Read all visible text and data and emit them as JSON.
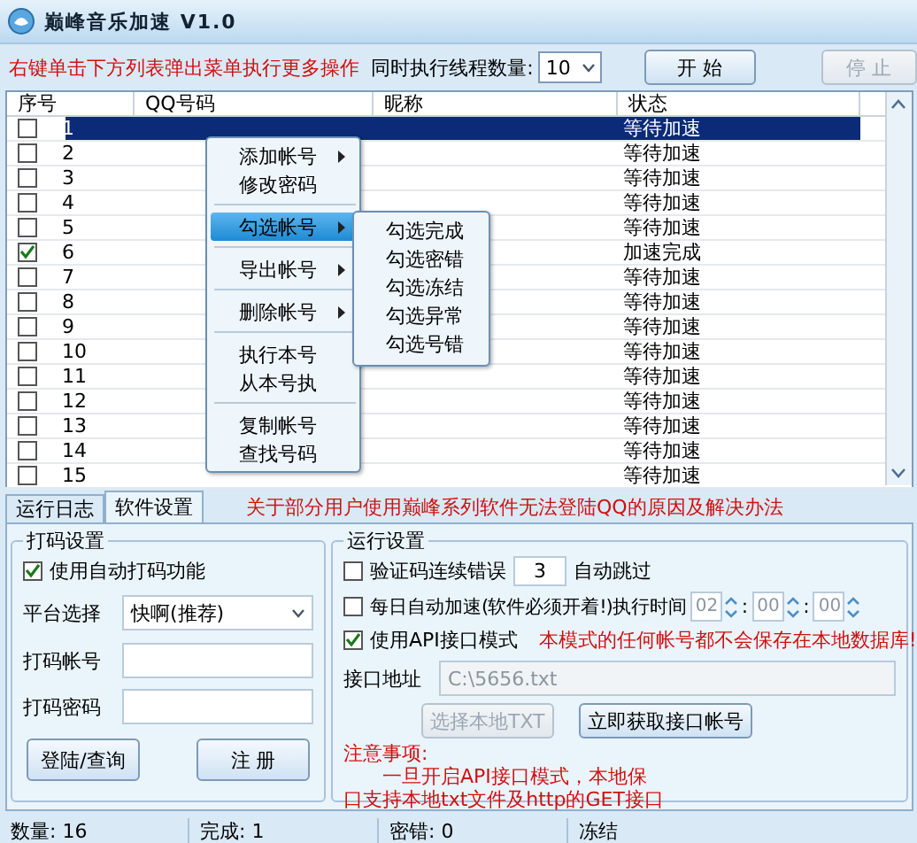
{
  "window": {
    "title": "巅峰音乐加速 V1.0"
  },
  "toolbar": {
    "hint": "右键单击下方列表弹出菜单执行更多操作",
    "threads_label": "同时执行线程数量:",
    "threads_value": "10",
    "buttons": [
      {
        "label": "开 始",
        "disabled": false
      },
      {
        "label": "停 止",
        "disabled": true
      }
    ]
  },
  "table": {
    "columns": [
      "序号",
      "QQ号码",
      "昵称",
      "状态"
    ],
    "rows": [
      {
        "index": "1",
        "checked": false,
        "selected": true,
        "status": "等待加速"
      },
      {
        "index": "2",
        "checked": false,
        "selected": false,
        "status": "等待加速"
      },
      {
        "index": "3",
        "checked": false,
        "selected": false,
        "status": "等待加速"
      },
      {
        "index": "4",
        "checked": false,
        "selected": false,
        "status": "等待加速"
      },
      {
        "index": "5",
        "checked": false,
        "selected": false,
        "status": "等待加速"
      },
      {
        "index": "6",
        "checked": true,
        "selected": false,
        "status": "加速完成"
      },
      {
        "index": "7",
        "checked": false,
        "selected": false,
        "status": "等待加速"
      },
      {
        "index": "8",
        "checked": false,
        "selected": false,
        "status": "等待加速"
      },
      {
        "index": "9",
        "checked": false,
        "selected": false,
        "status": "等待加速"
      },
      {
        "index": "10",
        "checked": false,
        "selected": false,
        "status": "等待加速"
      },
      {
        "index": "11",
        "checked": false,
        "selected": false,
        "status": "等待加速"
      },
      {
        "index": "12",
        "checked": false,
        "selected": false,
        "status": "等待加速"
      },
      {
        "index": "13",
        "checked": false,
        "selected": false,
        "status": "等待加速"
      },
      {
        "index": "14",
        "checked": false,
        "selected": false,
        "status": "等待加速"
      },
      {
        "index": "15",
        "checked": false,
        "selected": false,
        "status": "等待加速"
      }
    ]
  },
  "context_menu": {
    "items": [
      {
        "kind": "item",
        "label": "添加帐号",
        "submenu": true,
        "selected": false
      },
      {
        "kind": "item",
        "label": "修改密码",
        "submenu": false,
        "selected": false
      },
      {
        "kind": "separator"
      },
      {
        "kind": "item",
        "label": "勾选帐号",
        "submenu": true,
        "selected": true
      },
      {
        "kind": "separator"
      },
      {
        "kind": "item",
        "label": "导出帐号",
        "submenu": true,
        "selected": false
      },
      {
        "kind": "separator"
      },
      {
        "kind": "item",
        "label": "删除帐号",
        "submenu": true,
        "selected": false
      },
      {
        "kind": "separator"
      },
      {
        "kind": "item",
        "label": "执行本号",
        "submenu": false,
        "selected": false
      },
      {
        "kind": "item",
        "label": "从本号执",
        "submenu": false,
        "selected": false
      },
      {
        "kind": "separator"
      },
      {
        "kind": "item",
        "label": "复制帐号",
        "submenu": false,
        "selected": false
      },
      {
        "kind": "item",
        "label": "查找号码",
        "submenu": false,
        "selected": false
      }
    ]
  },
  "submenu": {
    "items": [
      "勾选完成",
      "勾选密错",
      "勾选冻结",
      "勾选异常",
      "勾选号错"
    ]
  },
  "tabs": [
    {
      "label": "运行日志",
      "selected": false
    },
    {
      "label": "软件设置",
      "selected": true
    }
  ],
  "notice_link": "关于部分用户使用巅峰系列软件无法登陆QQ的原因及解决办法",
  "captcha_settings": {
    "title": "打码设置",
    "auto": {
      "checked": true,
      "label": "使用自动打码功能"
    },
    "platform_label": "平台选择",
    "platform_value": "快啊(推荐)",
    "account_label": "打码帐号",
    "password_label": "打码密码",
    "buttons": [
      "登陆/查询",
      "注 册"
    ]
  },
  "run_settings": {
    "title": "运行设置",
    "captcha_retry": {
      "checked": false,
      "label": "验证码连续错误",
      "value": "3",
      "suffix": "自动跳过"
    },
    "daily": {
      "checked": false,
      "label": "每日自动加速(软件必须开着!)执行时间",
      "time": [
        "02",
        "00",
        "00"
      ],
      "separators": [
        ":",
        ":"
      ]
    },
    "api_mode": {
      "checked": true,
      "label": "使用API接口模式",
      "warning": "本模式的任何帐号都不会保存在本地数据库!"
    },
    "api_address": {
      "label": "接口地址",
      "value": "C:\\5656.txt",
      "disabled": true
    },
    "buttons": [
      {
        "label": "选择本地TXT",
        "disabled": true
      },
      {
        "label": "立即获取接口帐号",
        "disabled": false
      }
    ],
    "notes": [
      "注意事项:",
      "一旦开启API接口模式，本地保",
      "口支持本地txt文件及http的GET接口"
    ]
  },
  "status_bar": [
    "数量: 16",
    "完成: 1",
    "密错: 0",
    "冻结"
  ]
}
